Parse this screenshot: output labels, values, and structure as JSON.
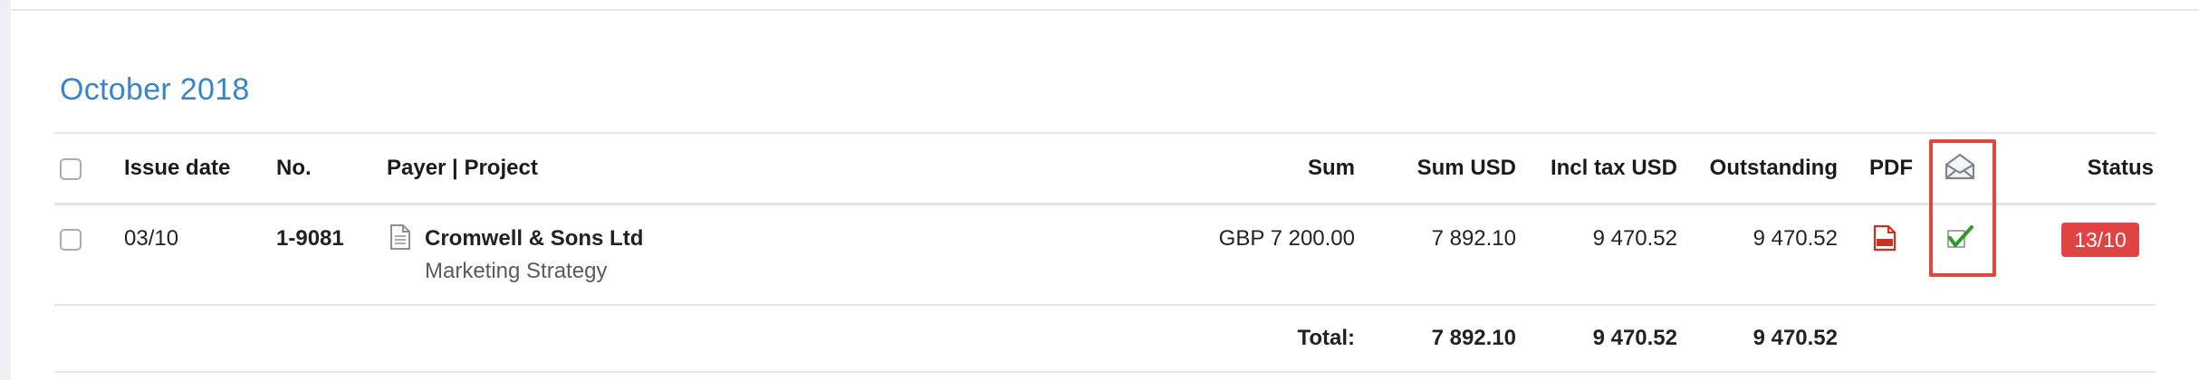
{
  "section": {
    "month_title": "October 2018"
  },
  "table": {
    "headers": {
      "issue_date": "Issue date",
      "number": "No.",
      "payer_project": "Payer | Project",
      "sum": "Sum",
      "sum_usd": "Sum USD",
      "incl_tax_usd": "Incl tax USD",
      "outstanding": "Outstanding",
      "pdf": "PDF",
      "sent_icon": "envelope-open-icon",
      "status": "Status"
    },
    "rows": [
      {
        "selected": false,
        "issue_date": "03/10",
        "number": "1-9081",
        "payer": "Cromwell & Sons Ltd",
        "project": "Marketing Strategy",
        "sum": "GBP 7 200.00",
        "sum_usd": "7 892.10",
        "incl_tax_usd": "9 470.52",
        "outstanding": "9 470.52",
        "pdf_icon": "pdf-file-icon",
        "sent_icon": "checkmark-icon",
        "status": "13/10",
        "status_color": "#e04343"
      }
    ],
    "totals": {
      "label": "Total:",
      "sum_usd": "7 892.10",
      "incl_tax_usd": "9 470.52",
      "outstanding": "9 470.52"
    }
  },
  "colors": {
    "accent": "#3a85c6",
    "highlight": "#e0483c",
    "checkmark": "#2e9a2e",
    "pdf": "#c8321f"
  }
}
